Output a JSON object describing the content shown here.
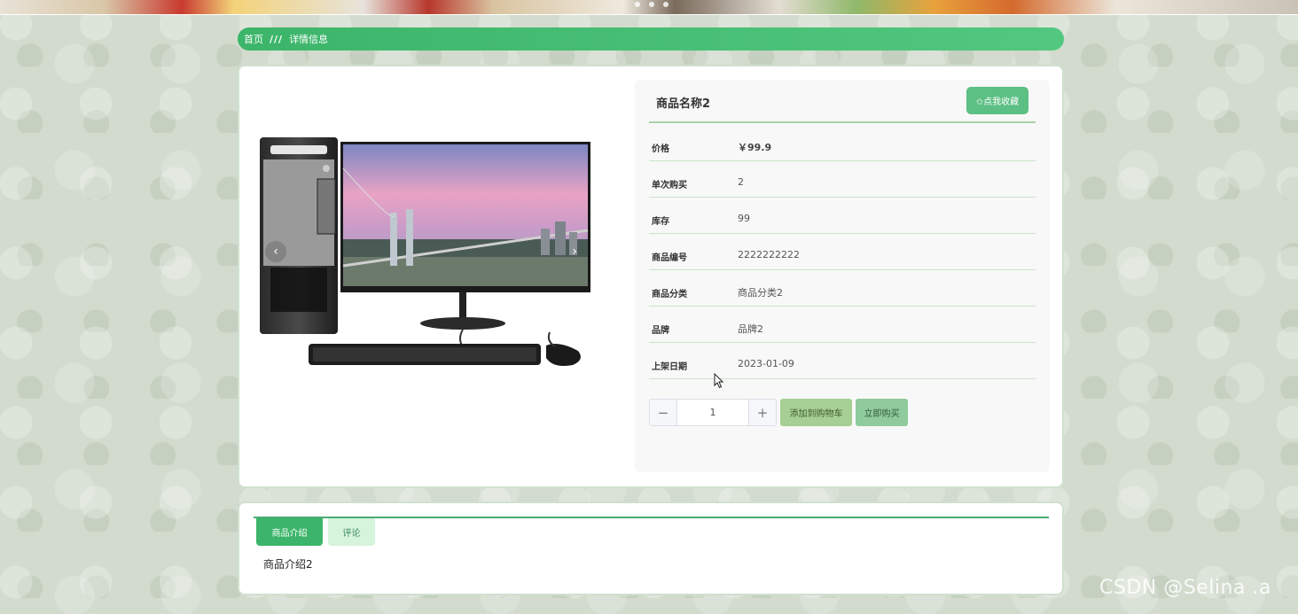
{
  "breadcrumb": {
    "home": "首页",
    "separator": "///",
    "current": "详情信息"
  },
  "product": {
    "name": "商品名称2",
    "favorite_label": "✩点我收藏",
    "fields": [
      {
        "label": "价格",
        "value": "￥99.9"
      },
      {
        "label": "单次购买",
        "value": "2"
      },
      {
        "label": "库存",
        "value": "99"
      },
      {
        "label": "商品编号",
        "value": "2222222222"
      },
      {
        "label": "商品分类",
        "value": "商品分类2"
      },
      {
        "label": "品牌",
        "value": "品牌2"
      },
      {
        "label": "上架日期",
        "value": "2023-01-09"
      }
    ],
    "quantity": "1",
    "minus_symbol": "−",
    "plus_symbol": "+",
    "add_to_cart_label": "添加到购物车",
    "buy_now_label": "立即购买",
    "image_icon": "desktop-computer-image",
    "carousel_prev": "‹",
    "carousel_next": "›"
  },
  "tabs": [
    {
      "label": "商品介绍",
      "active": true
    },
    {
      "label": "评论",
      "active": false
    }
  ],
  "tab_content": "商品介绍2",
  "watermark": "CSDN @Selina .a",
  "colors": {
    "accent": "#3cb56a",
    "favorite": "#5cbf84",
    "cart": "#a6cf93",
    "buy": "#8fcb9c"
  }
}
